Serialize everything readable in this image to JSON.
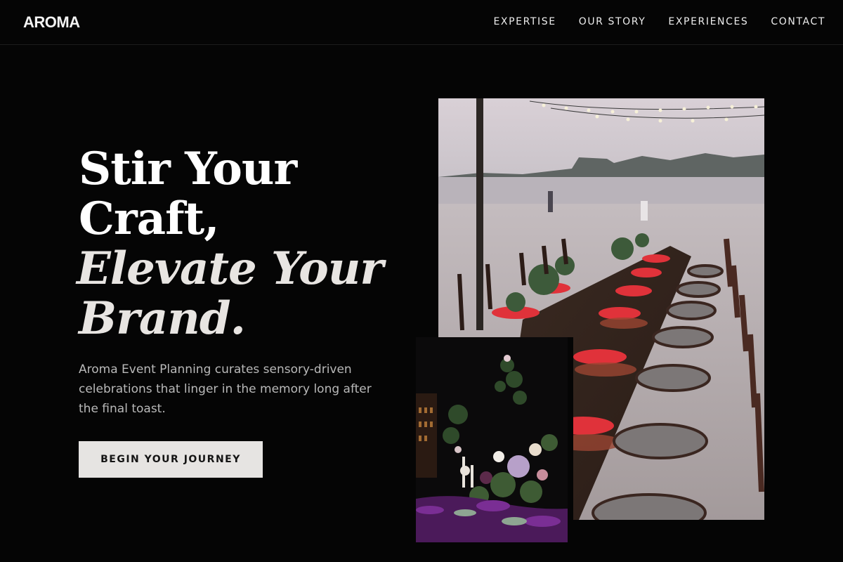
{
  "header": {
    "logo": "AROMA",
    "nav": [
      {
        "label": "EXPERTISE"
      },
      {
        "label": "OUR STORY"
      },
      {
        "label": "EXPERIENCES"
      },
      {
        "label": "CONTACT"
      }
    ]
  },
  "hero": {
    "headline_line1": "Stir Your",
    "headline_line2": "Craft,",
    "headline_line3": "Elevate Your",
    "headline_line4": "Brand.",
    "description": "Aroma Event Planning curates sensory-driven celebrations that linger in the memory long after the final toast.",
    "cta_label": "BEGIN YOUR JOURNEY"
  },
  "images": {
    "main_photo": "beach-dinner-table-photo",
    "secondary_photo": "floral-centerpiece-photo"
  },
  "colors": {
    "background": "#050505",
    "text": "#ffffff",
    "muted_text": "#b9b9b9",
    "button_bg": "#e6e4e2",
    "button_text": "#141414",
    "napkin_accent": "#e0323a"
  }
}
